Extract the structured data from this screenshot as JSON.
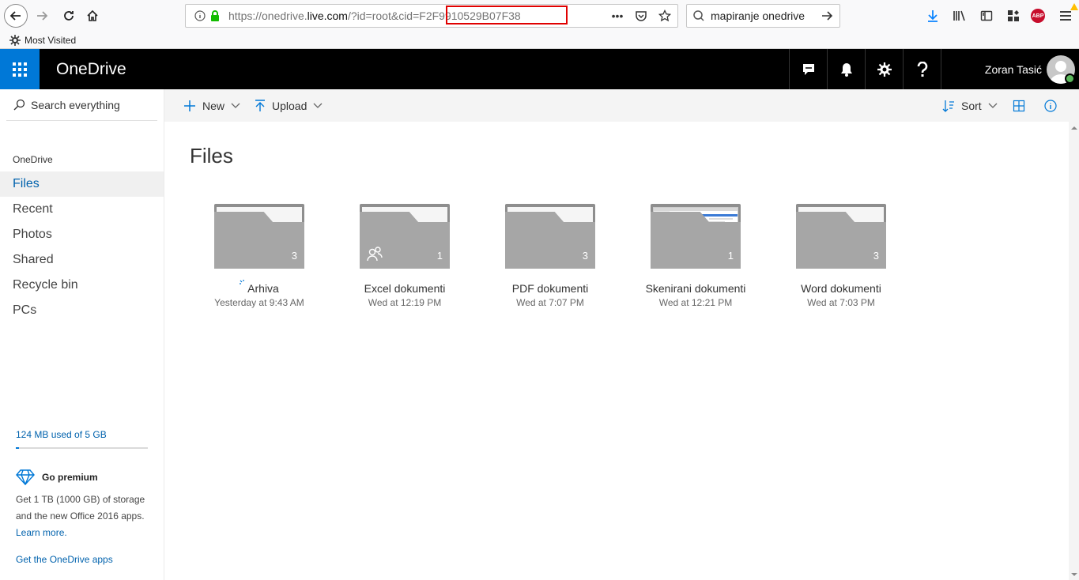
{
  "browser": {
    "url_prefix": "https://onedrive.",
    "url_host": "live.com",
    "url_path": "/?id=root&cid=F2F9910529B07F38",
    "search_text": "mapiranje onedrive",
    "bookmark_label": "Most Visited",
    "abp_label": "ABP",
    "highlight_color": "#e00000"
  },
  "header": {
    "brand": "OneDrive",
    "user_name": "Zoran Tasić",
    "accent": "#0078d7",
    "icons": [
      "feedback-icon",
      "bell-icon",
      "gear-icon",
      "help-icon"
    ]
  },
  "nav": {
    "search_placeholder": "Search everything",
    "section": "OneDrive",
    "items": [
      {
        "label": "Files",
        "active": true
      },
      {
        "label": "Recent"
      },
      {
        "label": "Photos"
      },
      {
        "label": "Shared"
      },
      {
        "label": "Recycle bin"
      },
      {
        "label": "PCs"
      }
    ],
    "quota_text": "124 MB used of 5 GB",
    "quota_fraction": 0.024,
    "premium_title": "Go premium",
    "premium_text": "Get 1 TB (1000 GB) of storage and the new Office 2016 apps.",
    "premium_link": "Learn more.",
    "get_apps": "Get the OneDrive apps"
  },
  "commands": {
    "new_label": "New",
    "upload_label": "Upload",
    "sort_label": "Sort"
  },
  "main": {
    "title": "Files",
    "folders": [
      {
        "name": "Arhiva",
        "date": "Yesterday at 9:43 AM",
        "count": "3",
        "syncing": true
      },
      {
        "name": "Excel dokumenti",
        "date": "Wed at 12:19 PM",
        "count": "1",
        "shared": true
      },
      {
        "name": "PDF dokumenti",
        "date": "Wed at 7:07 PM",
        "count": "3"
      },
      {
        "name": "Skenirani dokumenti",
        "date": "Wed at 12:21 PM",
        "count": "1",
        "thumbnail": true
      },
      {
        "name": "Word dokumenti",
        "date": "Wed at 7:03 PM",
        "count": "3"
      }
    ]
  }
}
